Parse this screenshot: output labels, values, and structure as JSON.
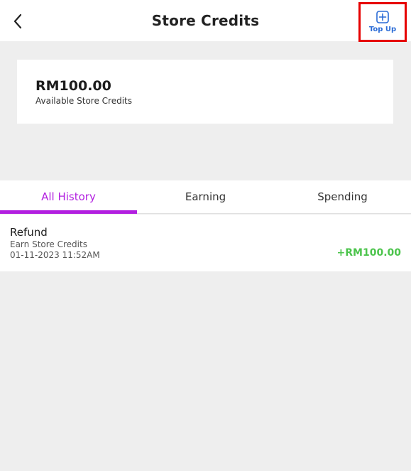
{
  "header": {
    "title": "Store Credits",
    "back_icon": "chevron-left-icon",
    "top_up": {
      "label": "Top Up",
      "icon": "plus-square-icon"
    }
  },
  "balance": {
    "amount": "RM100.00",
    "caption": "Available Store Credits"
  },
  "tabs": [
    {
      "label": "All History",
      "active": true
    },
    {
      "label": "Earning",
      "active": false
    },
    {
      "label": "Spending",
      "active": false
    }
  ],
  "history": [
    {
      "title": "Refund",
      "subtitle": "Earn Store Credits",
      "datetime": "01-11-2023 11:52AM",
      "amount": "+RM100.00"
    }
  ],
  "colors": {
    "accent": "#b21fe0",
    "topup_blue": "#2a6bd6",
    "highlight_red": "#e60000",
    "amount_green": "#4cc44c",
    "background": "#eeeeee"
  }
}
